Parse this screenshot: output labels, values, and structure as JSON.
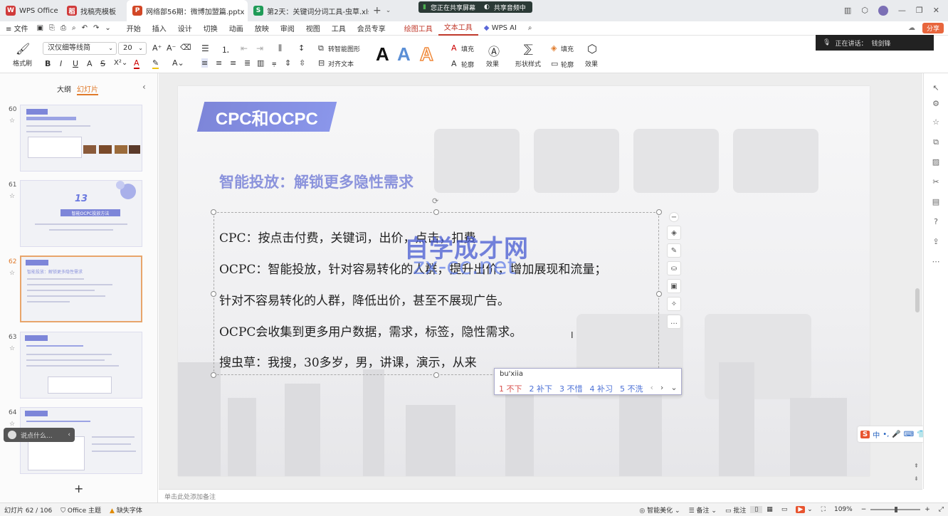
{
  "tabs": [
    {
      "label": "WPS Office",
      "icon": "wps-logo-icon",
      "color": "#d03b3b"
    },
    {
      "label": "找稿壳模板",
      "icon": "template-icon",
      "color": "#d03b3b"
    },
    {
      "label": "网络部56期：微博加盟篇.pptx",
      "icon": "ppt-icon",
      "color": "#d24726"
    },
    {
      "label": "第2天：关键词分词工具-虫草.xls",
      "icon": "xls-icon",
      "color": "#1f9b57"
    }
  ],
  "share_banner": {
    "sharing": "您正在共享屏幕",
    "audio": "共享音频中"
  },
  "menu": {
    "file": "文件",
    "items": [
      "开始",
      "插入",
      "设计",
      "切换",
      "动画",
      "放映",
      "审阅",
      "视图",
      "工具",
      "会员专享"
    ],
    "draw_tools": "绘图工具",
    "text_tools": "文本工具",
    "wps_ai": "WPS AI",
    "share": "分享"
  },
  "ribbon": {
    "format_painter": "格式刷",
    "font_name": "汉仪细等线简",
    "font_size": "20",
    "convert_smart": "转智能图形",
    "align_text": "对齐文本",
    "fill": "填充",
    "outline": "轮廓",
    "effects": "效果",
    "shape_style": "形状样式"
  },
  "speaking": {
    "label": "正在讲话：",
    "name": "钱剑锋"
  },
  "left_panel": {
    "outline_tab": "大纲",
    "slides_tab": "幻灯片",
    "slides": [
      {
        "num": "60"
      },
      {
        "num": "61",
        "big": "13",
        "caption": "智能OCPC投放方法"
      },
      {
        "num": "62",
        "caption": "智能投放：解锁更多隐性需求"
      },
      {
        "num": "63"
      },
      {
        "num": "64"
      }
    ],
    "add": "+"
  },
  "slide": {
    "title": "CPC和OCPC",
    "subtitle": "智能投放：解锁更多隐性需求",
    "lines": [
      "CPC：按点击付费，关键词，出价，点击，扣费",
      "OCPC：智能投放，针对容易转化的人群，提升出价，增加展现和流量；",
      "针对不容易转化的人群，降低出价，甚至不展现广告。",
      "OCPC会收集到更多用户数据，需求，标签，隐性需求。",
      "搜虫草：我搜，30多岁，男，讲课，演示，从来"
    ],
    "watermark_cn": "自学成才网",
    "watermark_en": "zx-cc.net"
  },
  "ime": {
    "pinyin": "bu'xiia",
    "candidates": [
      "1 不下",
      "2 补下",
      "3 不惜",
      "4 补习",
      "5 不洗"
    ]
  },
  "float_search": {
    "placeholder": "说点什么..."
  },
  "notes": {
    "placeholder": "单击此处添加备注"
  },
  "status": {
    "slide_count": "幻灯片 62 / 106",
    "theme": "Office 主题",
    "missing_font": "缺失字体",
    "beautify": "智能美化",
    "notes": "备注",
    "comments": "批注",
    "zoom": "109%"
  },
  "colors": {
    "accent": "#c0392b",
    "title_fill": "#8a96ea",
    "subtitle": "#8b93dc",
    "ime_candidate": "#4a6fd6"
  }
}
